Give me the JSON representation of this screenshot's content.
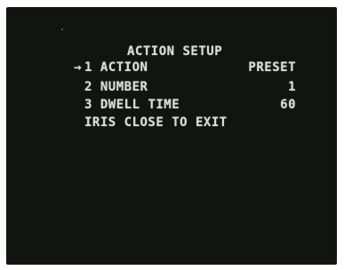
{
  "menu": {
    "title": "ACTION SETUP",
    "cursor_icon": "arrow-right",
    "cursor_glyph": "→",
    "items": [
      {
        "number": "1",
        "label": "ACTION",
        "value": "PRESET"
      },
      {
        "number": "2",
        "label": "NUMBER",
        "value": "1"
      },
      {
        "number": "3",
        "label": "DWELL TIME",
        "value": "60"
      }
    ],
    "footer": "IRIS CLOSE TO EXIT"
  },
  "colors": {
    "screen_bg": "#121410",
    "osd_text": "#d9ddd6"
  }
}
